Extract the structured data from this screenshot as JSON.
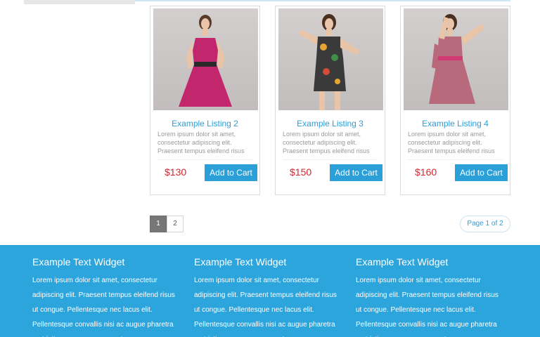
{
  "listings": [
    {
      "title": "Example Listing 2",
      "desc": "Lorem ipsum dolor sit amet, consectetur adipiscing elit. Praesent tempus eleifend risus",
      "price": "$130",
      "button": "Add to Cart",
      "dress_color": "#c2276e",
      "accent": "#2b9fd8"
    },
    {
      "title": "Example Listing 3",
      "desc": "Lorem ipsum dolor sit amet, consectetur adipiscing elit. Praesent tempus eleifend risus",
      "price": "$150",
      "button": "Add to Cart",
      "dress_color": "#3a3a3a",
      "accent": "#2b9fd8"
    },
    {
      "title": "Example Listing 4",
      "desc": "Lorem ipsum dolor sit amet, consectetur adipiscing elit. Praesent tempus eleifend risus",
      "price": "$160",
      "button": "Add to Cart",
      "dress_color": "#b86a7c",
      "accent": "#2b9fd8"
    }
  ],
  "pagination": {
    "pages": [
      "1",
      "2"
    ],
    "active": "1",
    "summary": "Page 1 of 2"
  },
  "footer": {
    "background": "#2ca4dc",
    "widgets": [
      {
        "title": "Example Text Widget",
        "body": "Lorem ipsum dolor sit amet, consectetur adipiscing elit. Praesent tempus eleifend risus ut congue. Pellentesque nec lacus elit. Pellentesque convallis nisi ac augue pharetra eu tristique neque consequat."
      },
      {
        "title": "Example Text Widget",
        "body": "Lorem ipsum dolor sit amet, consectetur adipiscing elit. Praesent tempus eleifend risus ut congue. Pellentesque nec lacus elit. Pellentesque convallis nisi ac augue pharetra eu tristique neque consequat."
      },
      {
        "title": "Example Text Widget",
        "body": "Lorem ipsum dolor sit amet, consectetur adipiscing elit. Praesent tempus eleifend risus ut congue. Pellentesque nec lacus elit. Pellentesque convallis nisi ac augue pharetra eu tristique neque consequat."
      }
    ]
  }
}
